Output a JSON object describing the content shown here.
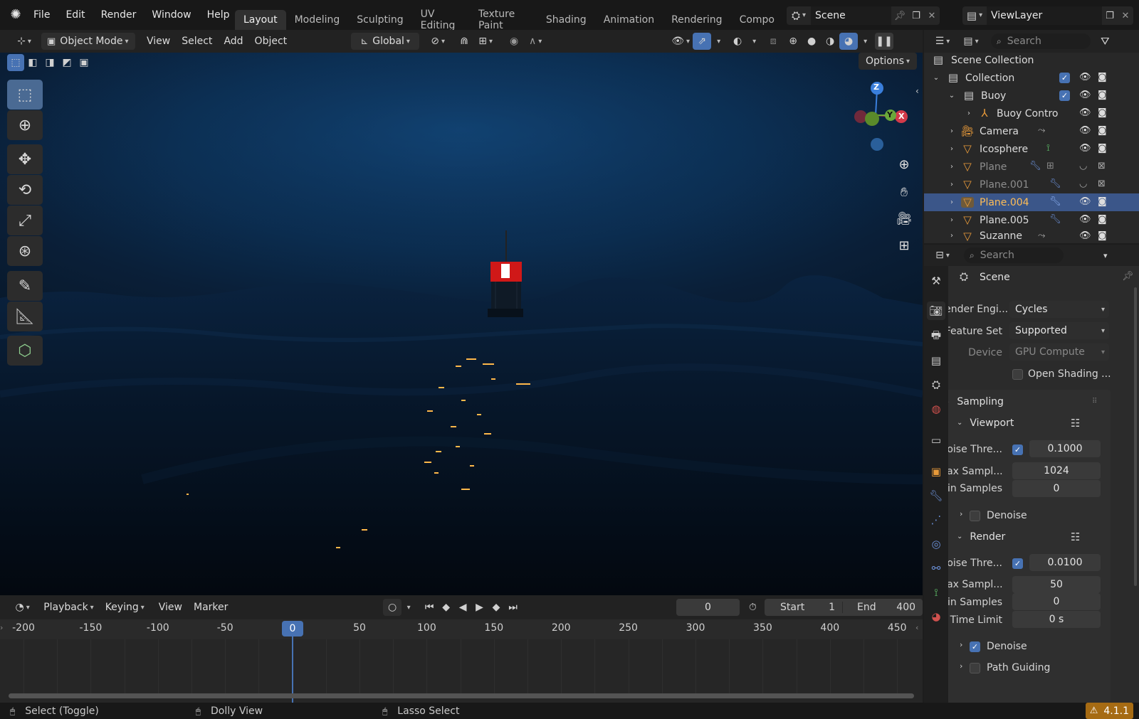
{
  "menubar": {
    "items": [
      "File",
      "Edit",
      "Render",
      "Window",
      "Help"
    ]
  },
  "workspaces": [
    "Layout",
    "Modeling",
    "Sculpting",
    "UV Editing",
    "Texture Paint",
    "Shading",
    "Animation",
    "Rendering",
    "Compo"
  ],
  "active_workspace": "Layout",
  "scene_selector": {
    "label": "Scene"
  },
  "viewlayer_selector": {
    "label": "ViewLayer"
  },
  "viewport_header": {
    "mode": "Object Mode",
    "menus": [
      "View",
      "Select",
      "Add",
      "Object"
    ],
    "orientation": "Global",
    "options": "Options"
  },
  "viewport": {
    "gizmo_axes": [
      "Z",
      "Y",
      "X"
    ]
  },
  "timeline_header": {
    "menus": [
      "Playback",
      "Keying",
      "View",
      "Marker"
    ],
    "current_frame": "0",
    "start_label": "Start",
    "start_value": "1",
    "end_label": "End",
    "end_value": "400"
  },
  "timeline": {
    "ticks": [
      "-200",
      "-150",
      "-100",
      "-50",
      "0",
      "50",
      "100",
      "150",
      "200",
      "250",
      "300",
      "350",
      "400",
      "450"
    ],
    "playhead": "0"
  },
  "statusbar": {
    "hints": [
      "Select (Toggle)",
      "Dolly View",
      "Lasso Select"
    ],
    "version": "4.1.1"
  },
  "outliner": {
    "search_placeholder": "Search",
    "rows": [
      {
        "name": "Scene Collection"
      },
      {
        "name": "Collection"
      },
      {
        "name": "Buoy"
      },
      {
        "name": "Buoy Contro"
      },
      {
        "name": "Camera"
      },
      {
        "name": "Icosphere"
      },
      {
        "name": "Plane"
      },
      {
        "name": "Plane.001"
      },
      {
        "name": "Plane.004"
      },
      {
        "name": "Plane.005"
      },
      {
        "name": "Suzanne"
      }
    ]
  },
  "properties": {
    "search_placeholder": "Search",
    "context": "Scene",
    "render_engine_label": "Render Engi...",
    "render_engine": "Cycles",
    "feature_set_label": "Feature Set",
    "feature_set": "Supported",
    "device_label": "Device",
    "device": "GPU Compute",
    "open_shading": "Open Shading ...",
    "sampling": "Sampling",
    "viewport_section": "Viewport",
    "vp_noise_label": "Noise Thre...",
    "vp_noise": "0.1000",
    "vp_max_label": "Max Sampl...",
    "vp_max": "1024",
    "vp_min_label": "Min Samples",
    "vp_min": "0",
    "vp_denoise": "Denoise",
    "render_section": "Render",
    "r_noise_label": "Noise Thre...",
    "r_noise": "0.0100",
    "r_max_label": "Max Sampl...",
    "r_max": "50",
    "r_min_label": "Min Samples",
    "r_min": "0",
    "r_time_label": "Time Limit",
    "r_time": "0 s",
    "r_denoise": "Denoise",
    "path_guiding": "Path Guiding"
  }
}
